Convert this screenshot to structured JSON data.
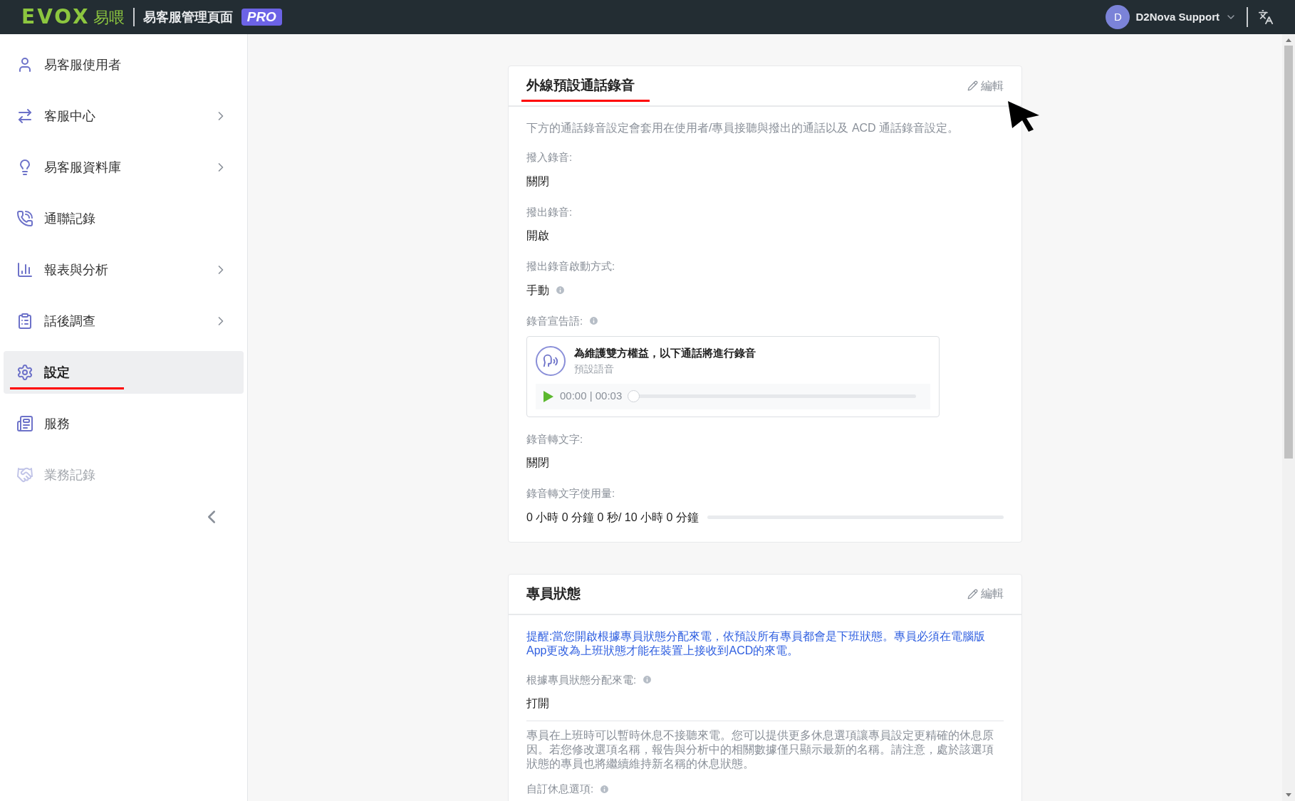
{
  "header": {
    "logo": "EVOX",
    "logo_suffix": "易喂",
    "title": "易客服管理頁面",
    "badge": "PRO",
    "user": {
      "initial": "D",
      "name": "D2Nova Support"
    }
  },
  "sidebar": {
    "items": [
      {
        "label": "易客服使用者",
        "expandable": false,
        "selected": false,
        "disabled": false,
        "underlined": false
      },
      {
        "label": "客服中心",
        "expandable": true,
        "selected": false,
        "disabled": false,
        "underlined": false
      },
      {
        "label": "易客服資料庫",
        "expandable": true,
        "selected": false,
        "disabled": false,
        "underlined": false
      },
      {
        "label": "通聯記錄",
        "expandable": false,
        "selected": false,
        "disabled": false,
        "underlined": false
      },
      {
        "label": "報表與分析",
        "expandable": true,
        "selected": false,
        "disabled": false,
        "underlined": false
      },
      {
        "label": "話後調查",
        "expandable": true,
        "selected": false,
        "disabled": false,
        "underlined": false
      },
      {
        "label": "設定",
        "expandable": false,
        "selected": true,
        "disabled": false,
        "underlined": true
      },
      {
        "label": "服務",
        "expandable": false,
        "selected": false,
        "disabled": false,
        "underlined": false
      },
      {
        "label": "業務記錄",
        "expandable": false,
        "selected": false,
        "disabled": true,
        "underlined": false
      }
    ]
  },
  "cards": [
    {
      "title": "外線預設通話錄音",
      "title_underlined": true,
      "edit": "編輯",
      "description": "下方的通話錄音設定會套用在使用者/專員接聽與撥出的通話以及 ACD 通話錄音設定。",
      "notice": false,
      "fields": [
        {
          "kind": "text",
          "label": "撥入錄音:",
          "value": "關閉",
          "info": false,
          "value_info": false
        },
        {
          "kind": "text",
          "label": "撥出錄音:",
          "value": "開啟",
          "info": false,
          "value_info": false
        },
        {
          "kind": "text",
          "label": "撥出錄音啟動方式:",
          "value": "手動",
          "info": false,
          "value_info": true
        },
        {
          "kind": "announcement",
          "label": "錄音宣告語:",
          "info": true,
          "message": "為維護雙方權益，以下通話將進行錄音",
          "subtitle": "預設語音",
          "time": "00:00 | 00:03",
          "level": 0
        },
        {
          "kind": "text",
          "label": "錄音轉文字:",
          "value": "關閉",
          "info": false,
          "value_info": false
        },
        {
          "kind": "usage",
          "label": "錄音轉文字使用量:",
          "value": "0 小時 0 分鐘 0 秒/ 10 小時 0 分鐘",
          "info": false,
          "level": 0
        }
      ]
    },
    {
      "title": "專員狀態",
      "title_underlined": false,
      "edit": "編輯",
      "description": "提醒:當您開啟根據專員狀態分配來電，依預設所有專員都會是下班狀態。專員必須在電腦版App更改為上班狀態才能在裝置上接收到ACD的來電。",
      "notice": true,
      "fields": [
        {
          "kind": "text",
          "label": "根據專員狀態分配來電:",
          "value": "打開",
          "info": true,
          "value_info": false
        },
        {
          "kind": "paragraph",
          "value": "專員在上班時可以暫時休息不接聽來電。您可以提供更多休息選項讓專員設定更精確的休息原因。若您修改選項名稱，報告與分析中的相關數據僅只顯示最新的名稱。請注意，處於該選項狀態的專員也將繼續維持新名稱的休息狀態。"
        },
        {
          "kind": "text",
          "label": "自訂休息選項:",
          "info": true
        }
      ]
    }
  ]
}
